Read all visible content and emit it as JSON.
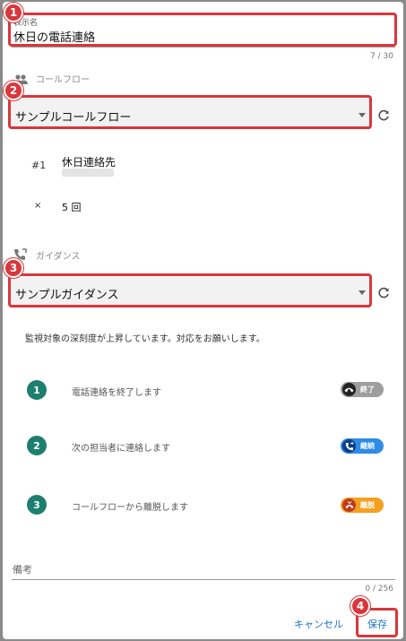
{
  "display_name": {
    "label": "表示名",
    "value": "休日の電話連絡",
    "counter": "7 / 30"
  },
  "callflow": {
    "section_label": "コールフロー",
    "selected": "サンプルコールフロー",
    "rows": [
      {
        "prefix": "#1",
        "title": "休日連絡先",
        "subtitle": ""
      },
      {
        "prefix": "×",
        "title": "5 回"
      }
    ]
  },
  "guidance": {
    "section_label": "ガイダンス",
    "selected": "サンプルガイダンス",
    "message": "監視対象の深刻度が上昇しています。対応をお願いします。",
    "steps": [
      {
        "number": "1",
        "text": "電話連絡を終了します",
        "chip_label": "終了",
        "chip_icon": "hangup-icon"
      },
      {
        "number": "2",
        "text": "次の担当者に連絡します",
        "chip_label": "継続",
        "chip_icon": "phone-forward-icon"
      },
      {
        "number": "3",
        "text": "コールフローから離脱します",
        "chip_label": "離脱",
        "chip_icon": "phone-exit-icon"
      }
    ]
  },
  "notes": {
    "label": "備考",
    "counter": "0 / 256"
  },
  "actions": {
    "cancel": "キャンセル",
    "save": "保存"
  },
  "annotations": [
    "1",
    "2",
    "3",
    "4"
  ],
  "colors": {
    "highlight": "#d9363b",
    "step_green": "#1d7f6e",
    "chip_end": "#9e9e9e",
    "chip_continue": "#2f8be6",
    "chip_exit": "#f5a020",
    "link_blue": "#1e73c8"
  }
}
